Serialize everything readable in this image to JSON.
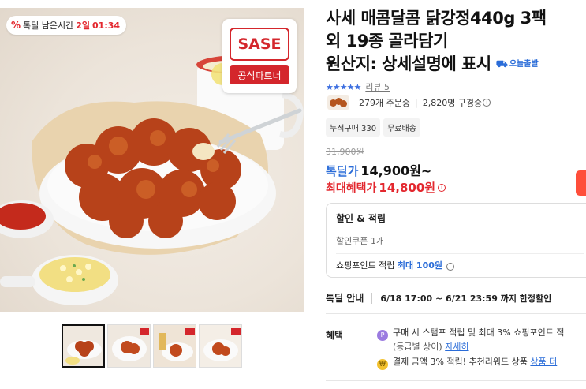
{
  "deal_badge": {
    "percent_icon": "%",
    "label": "톡딜 남은시간",
    "days": "2일",
    "time": "01:34"
  },
  "brand": {
    "name": "SASE",
    "sub": "공식파트너"
  },
  "product": {
    "title_lines": [
      "사세 매콤달콤 닭강정440g 3팩",
      "외 19종 골라담기",
      "원산지: 상세설명에 표시"
    ],
    "today_ship": "오늘출발",
    "stars": "★★★★★",
    "reviews": "리뷰 5",
    "orders": "279개 주문중",
    "viewers": "2,820명 구경중",
    "chips": [
      "누적구매 330",
      "무료배송"
    ]
  },
  "price": {
    "original": "31,900원",
    "deal_label": "톡딜가",
    "deal_value": "14,900원~",
    "max_label": "최대혜택가",
    "max_value": "14,800원"
  },
  "benefits_box": {
    "title": "할인 & 적립",
    "coupon": "할인쿠폰 1개",
    "points_prefix": "쇼핑포인트 적립",
    "points_highlight": "최대 100원"
  },
  "deal_info": {
    "label": "톡딜 안내",
    "period": "6/18 17:00 ~ 6/21 23:59 까지 한정할인"
  },
  "perks": {
    "label": "혜택",
    "stamp": {
      "icon": "P",
      "text": "구매 시 스탬프 적립 및 최대 3% 쇼핑포인트 적",
      "sub": "(등급별 상이)",
      "link": "자세히"
    },
    "reward": {
      "icon": "₩",
      "text": "결제 금액 3% 적립! 추천리워드 상품",
      "link": "상품 더"
    }
  },
  "colors": {
    "accent_blue": "#2a6cd8",
    "accent_red": "#e3272e",
    "brand_red": "#d4262c"
  }
}
